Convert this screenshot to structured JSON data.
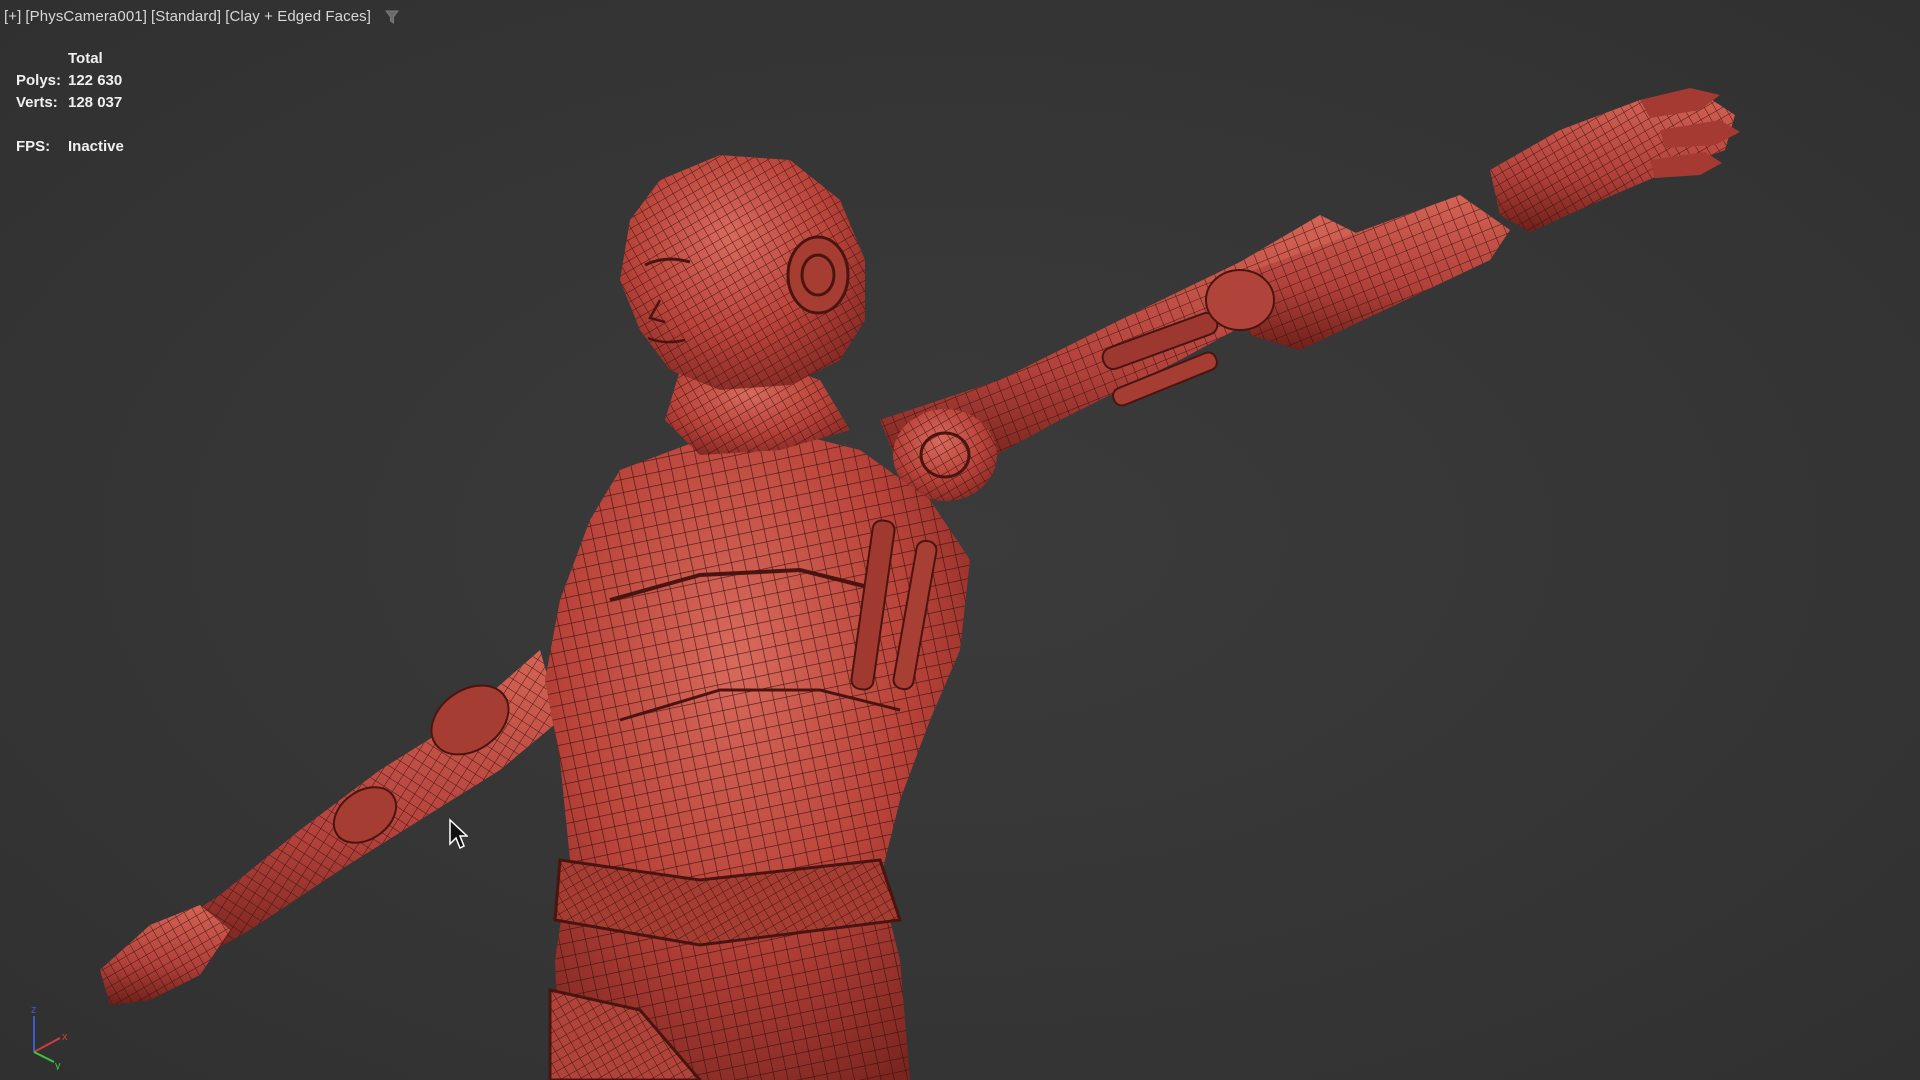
{
  "viewport": {
    "label_segments": [
      "[+]",
      "[PhysCamera001]",
      "[Standard]",
      "[Clay + Edged Faces]"
    ],
    "filter_icon": "filter-icon"
  },
  "stats": {
    "header": "Total",
    "polys_label": "Polys:",
    "polys_value": "122 630",
    "verts_label": "Verts:",
    "verts_value": "128 037",
    "fps_label": "FPS:",
    "fps_value": "Inactive"
  },
  "axis": {
    "z": "z",
    "x": "x",
    "y": "y",
    "colors": {
      "x": "#d23c3c",
      "y": "#3cc83c",
      "z": "#3c5ad2"
    }
  },
  "colors": {
    "background": "#373737",
    "clay": "#b8433a",
    "wire": "#3a100c",
    "text": "#e6e6e6"
  }
}
